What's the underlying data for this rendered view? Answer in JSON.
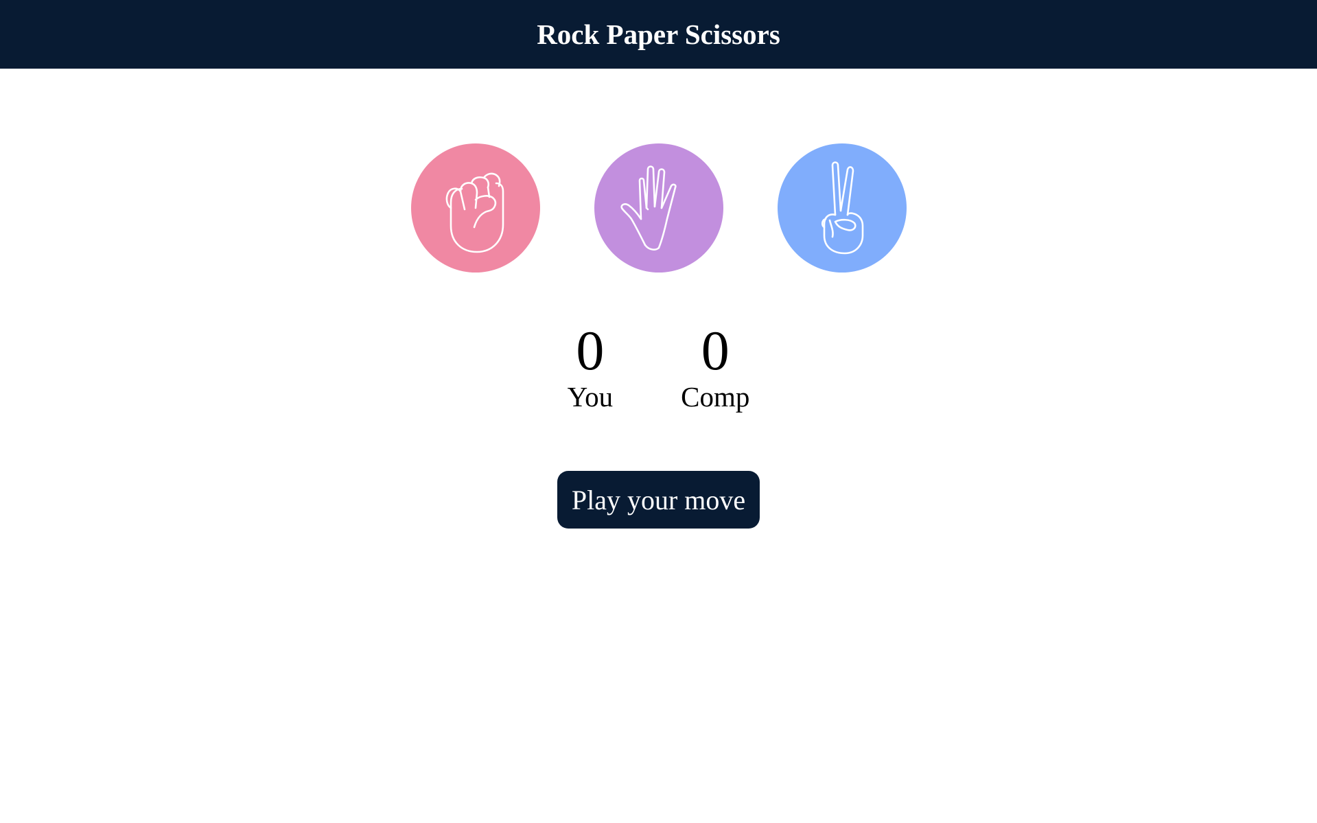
{
  "header": {
    "title": "Rock Paper Scissors"
  },
  "choices": [
    {
      "id": "rock",
      "icon": "fist-icon",
      "color": "#f088a3"
    },
    {
      "id": "paper",
      "icon": "open-hand-icon",
      "color": "#c28fde"
    },
    {
      "id": "scissors",
      "icon": "peace-hand-icon",
      "color": "#80adfc"
    }
  ],
  "scoreboard": {
    "user": {
      "score": "0",
      "label": "You"
    },
    "comp": {
      "score": "0",
      "label": "Comp"
    }
  },
  "message": {
    "text": "Play your move",
    "bg": "#081b33"
  }
}
